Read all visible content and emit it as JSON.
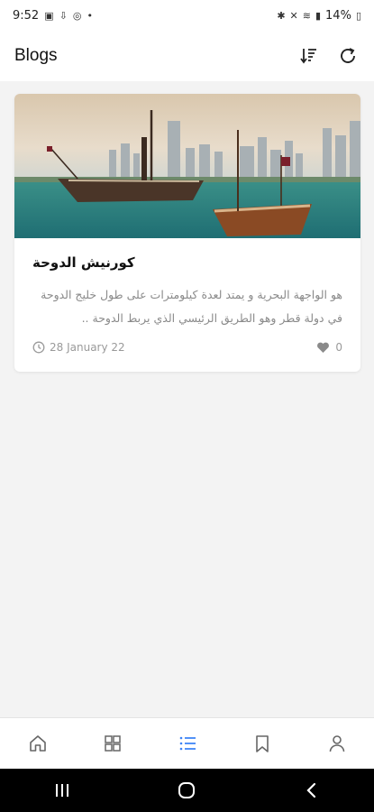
{
  "status_bar": {
    "time": "9:52",
    "battery": "14%"
  },
  "header": {
    "title": "Blogs"
  },
  "posts": [
    {
      "title": "كورنيش الدوحة",
      "excerpt": "هو الواجهة البحرية و يمتد لعدة كيلومترات على طول خليج الدوحة في دولة قطر وهو الطريق الرئيسي الذي يربط الدوحة ..",
      "date": "28 January 22",
      "likes": "0"
    }
  ],
  "nav": {
    "items": [
      "home-icon",
      "grid-icon",
      "list-icon",
      "bookmark-icon",
      "profile-icon"
    ],
    "active_index": 2,
    "active_color": "#3b82f6",
    "inactive_color": "#666666"
  }
}
